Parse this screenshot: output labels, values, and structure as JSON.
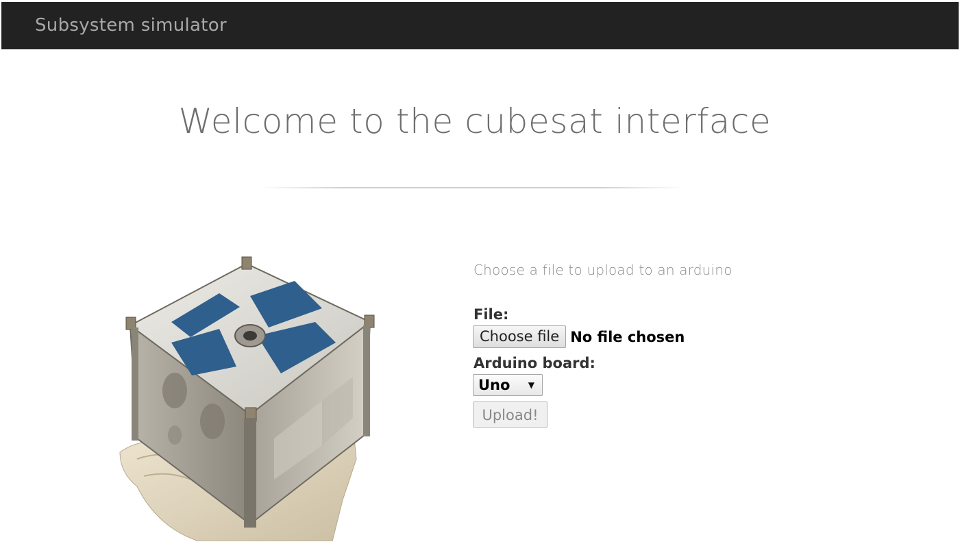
{
  "navbar": {
    "brand": "Subsystem simulator",
    "background": "#222222"
  },
  "main": {
    "title": "Welcome to the cubesat interface",
    "image": {
      "name": "cubesat-photo"
    }
  },
  "upload_form": {
    "instructions": "Choose a file to upload to an arduino",
    "file_label": "File:",
    "choose_file_label": "Choose file",
    "file_status": "No file chosen",
    "board_label": "Arduino board:",
    "board_selected": "Uno",
    "upload_label": "Upload!"
  }
}
